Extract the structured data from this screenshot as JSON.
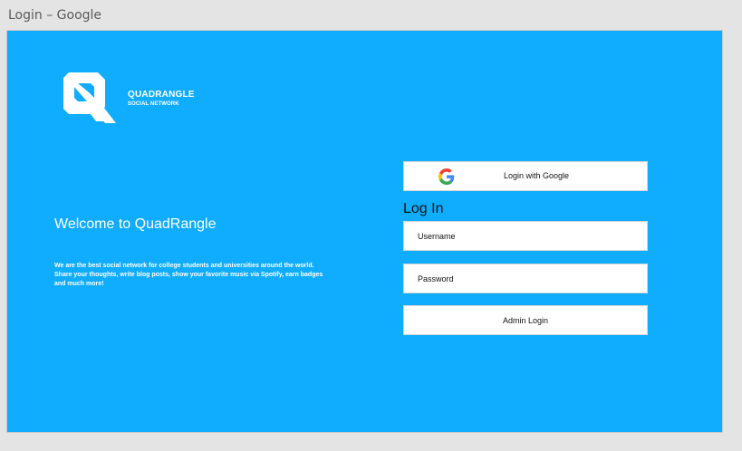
{
  "window": {
    "title": "Login – Google"
  },
  "brand": {
    "name": "QUADRANGLE",
    "tagline": "SOCIAL NETWORK",
    "logo_icon": "quadrangle-q-logo-icon"
  },
  "hero": {
    "heading": "Welcome to QuadRangle",
    "description": "We are the best social network for college students and universities around the world. Share your thoughts, write blog posts, show your favorite music via Spotify, earn badges and much more!"
  },
  "login": {
    "google_button_label": "Login with Google",
    "google_icon": "google-g-icon",
    "heading": "Log In",
    "username_placeholder": "Username",
    "password_placeholder": "Password",
    "admin_button_label": "Admin Login"
  },
  "colors": {
    "background": "#10acfe",
    "window": "#e4e4e4",
    "field": "#ffffff"
  }
}
